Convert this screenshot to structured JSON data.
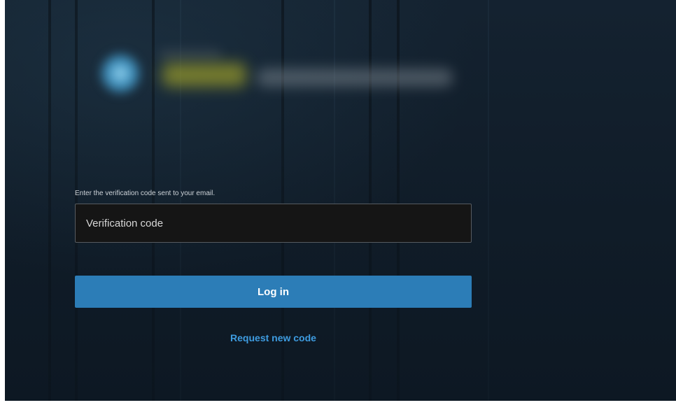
{
  "login": {
    "hint": "Enter the verification code sent to your email.",
    "code_placeholder": "Verification code",
    "code_value": "",
    "login_label": "Log in",
    "request_label": "Request new code"
  },
  "colors": {
    "background": "#111e2a",
    "button": "#2c7db7",
    "link": "#3e9ce0",
    "input_bg": "#151515"
  }
}
